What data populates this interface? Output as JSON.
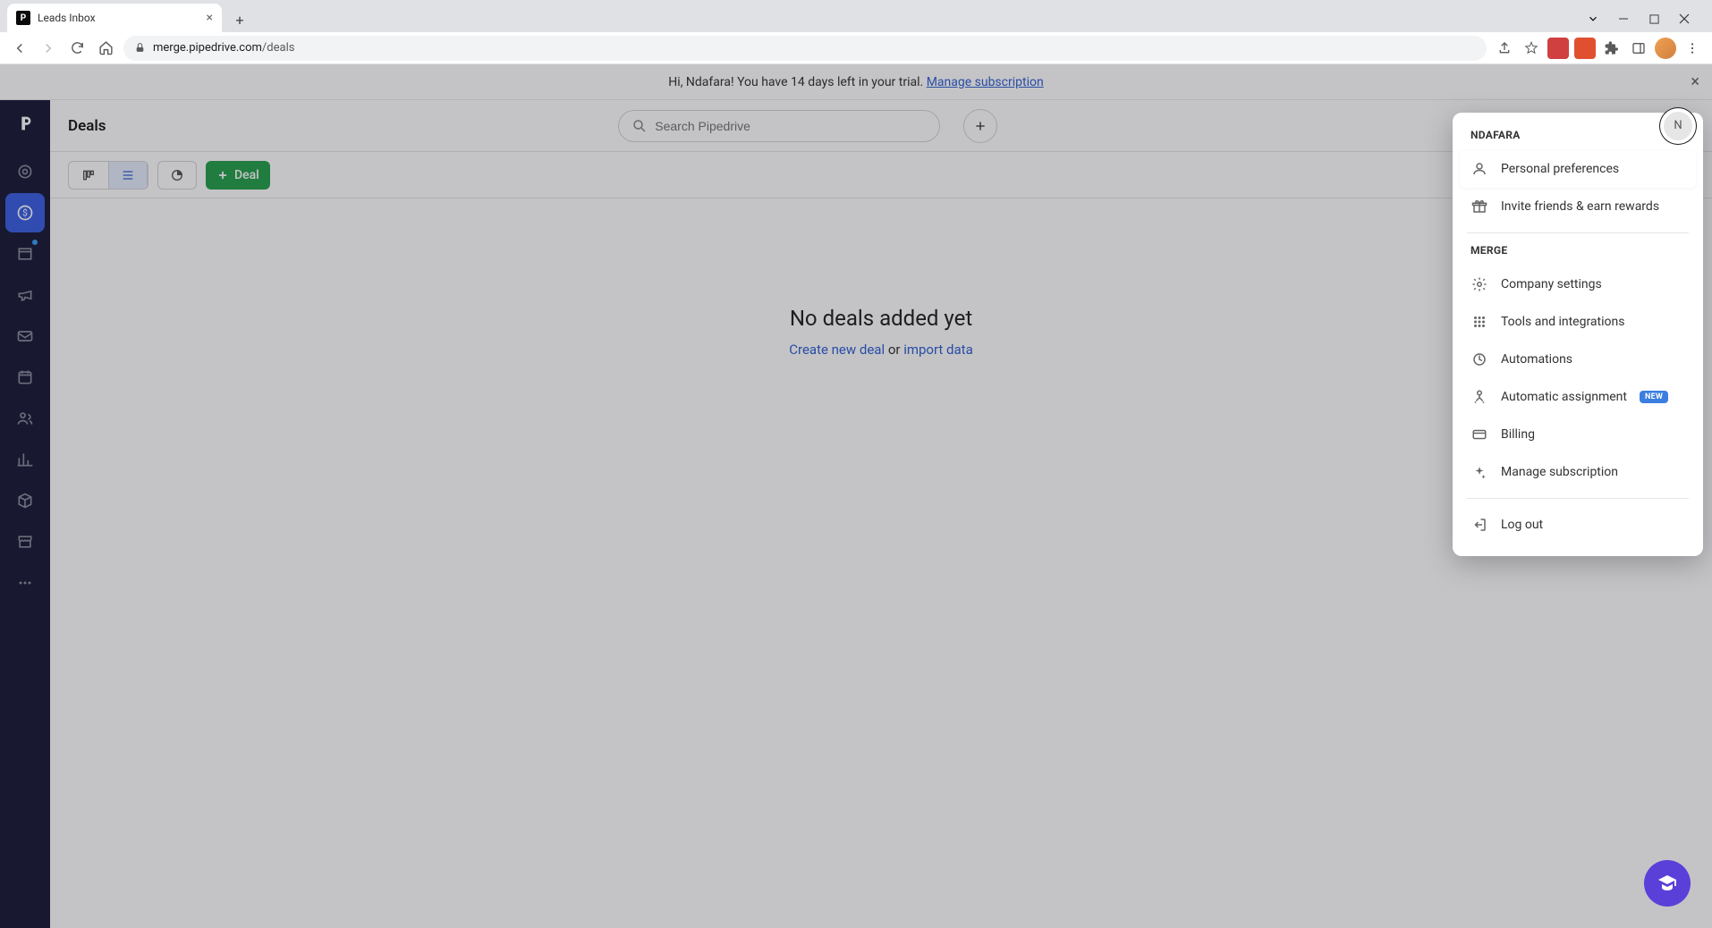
{
  "browser": {
    "tab_title": "Leads Inbox",
    "url_prefix": "merge.pipedrive.com",
    "url_path": "/deals"
  },
  "banner": {
    "greeting": "Hi, Ndafara! You have 14 days left in your trial. ",
    "link": "Manage subscription"
  },
  "header": {
    "page_title": "Deals",
    "search_placeholder": "Search Pipedrive",
    "avatar_initial": "N"
  },
  "toolbar": {
    "deal_button": "Deal"
  },
  "empty": {
    "title": "No deals added yet",
    "create_link": "Create new deal",
    "or_text": " or ",
    "import_link": "import data"
  },
  "user_menu": {
    "section1_header": "NDAFARA",
    "personal_prefs": "Personal preferences",
    "invite": "Invite friends & earn rewards",
    "section2_header": "MERGE",
    "company": "Company settings",
    "tools": "Tools and integrations",
    "automations": "Automations",
    "auto_assign": "Automatic assignment",
    "auto_assign_badge": "NEW",
    "billing": "Billing",
    "manage_sub": "Manage subscription",
    "logout": "Log out"
  }
}
